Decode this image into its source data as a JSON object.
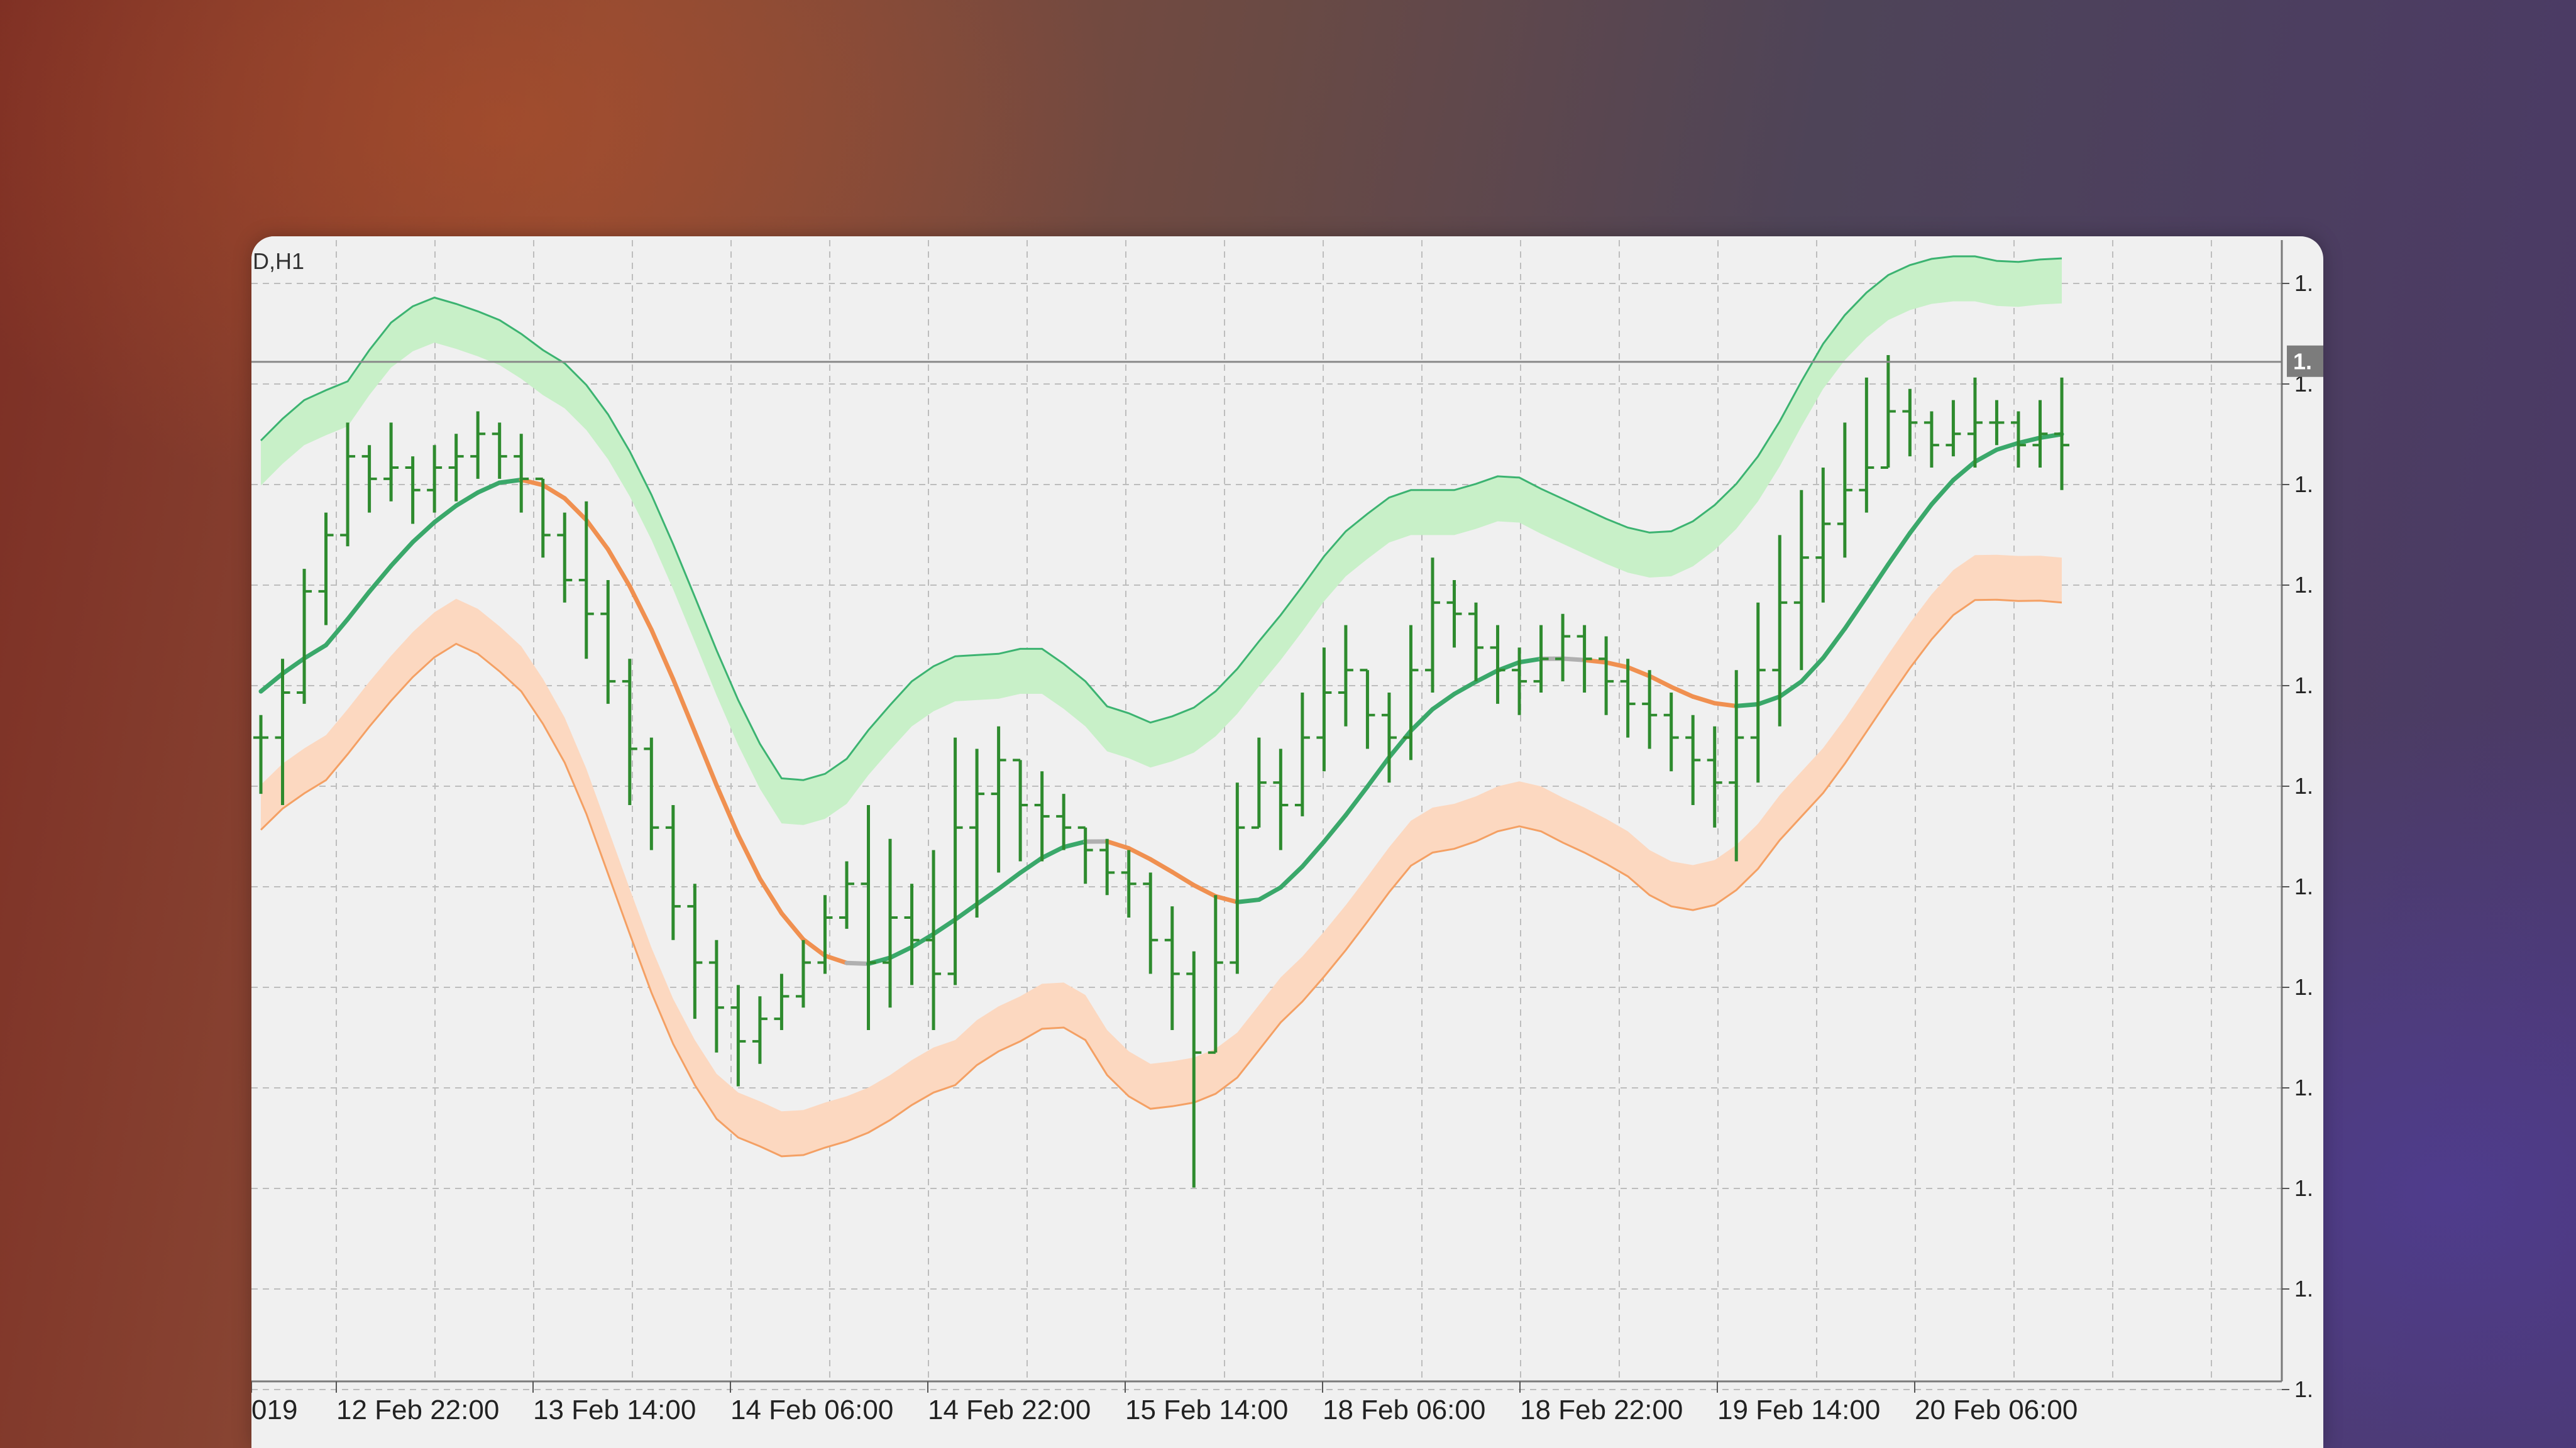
{
  "window": {
    "symbol_label": "D,H1"
  },
  "price_axis": {
    "tick_labels": [
      "1.",
      "1.",
      "1.",
      "1.",
      "1.",
      "1.",
      "1.",
      "1.",
      "1.",
      "1.",
      "1.",
      "1."
    ],
    "current_price_label": "1."
  },
  "colors": {
    "background": "#f0f0f0",
    "grid": "#bdbdbd",
    "bar": "#2e8b2e",
    "upper_band": "#3cb371",
    "upper_fill": "#c8f0c8",
    "lower_band": "#f4a064",
    "lower_fill": "#fcd8c0",
    "ma_up": "#3aa86a",
    "ma_down": "#f09050",
    "ma_flat": "#b0b0b0"
  },
  "chart_data": {
    "type": "ohlc",
    "title": "",
    "x_tick_labels": [
      "019",
      "12 Feb 22:00",
      "13 Feb 14:00",
      "14 Feb 06:00",
      "14 Feb 22:00",
      "15 Feb 14:00",
      "18 Feb 06:00",
      "18 Feb 22:00",
      "19 Feb 14:00",
      "20 Feb 06:00"
    ],
    "y_range": [
      0.0,
      100.0
    ],
    "y_note_values_are_relative_to_axis": true,
    "current_price": 89.4,
    "bars": [
      {
        "h": 58,
        "l": 51,
        "c": 56
      },
      {
        "h": 63,
        "l": 50,
        "c": 60
      },
      {
        "h": 71,
        "l": 59,
        "c": 69
      },
      {
        "h": 76,
        "l": 66,
        "c": 74
      },
      {
        "h": 84,
        "l": 73,
        "c": 81
      },
      {
        "h": 82,
        "l": 76,
        "c": 79
      },
      {
        "h": 84,
        "l": 77,
        "c": 80
      },
      {
        "h": 81,
        "l": 75,
        "c": 78
      },
      {
        "h": 82,
        "l": 76,
        "c": 80
      },
      {
        "h": 83,
        "l": 77,
        "c": 81
      },
      {
        "h": 85,
        "l": 79,
        "c": 83
      },
      {
        "h": 84,
        "l": 79,
        "c": 81
      },
      {
        "h": 83,
        "l": 76,
        "c": 79
      },
      {
        "h": 79,
        "l": 72,
        "c": 74
      },
      {
        "h": 76,
        "l": 68,
        "c": 70
      },
      {
        "h": 77,
        "l": 63,
        "c": 67
      },
      {
        "h": 70,
        "l": 59,
        "c": 61
      },
      {
        "h": 63,
        "l": 50,
        "c": 55
      },
      {
        "h": 56,
        "l": 46,
        "c": 48
      },
      {
        "h": 50,
        "l": 38,
        "c": 41
      },
      {
        "h": 43,
        "l": 31,
        "c": 36
      },
      {
        "h": 38,
        "l": 28,
        "c": 32
      },
      {
        "h": 34,
        "l": 25,
        "c": 29
      },
      {
        "h": 33,
        "l": 27,
        "c": 31
      },
      {
        "h": 35,
        "l": 30,
        "c": 33
      },
      {
        "h": 38,
        "l": 32,
        "c": 36
      },
      {
        "h": 42,
        "l": 35,
        "c": 40
      },
      {
        "h": 45,
        "l": 39,
        "c": 43
      },
      {
        "h": 50,
        "l": 30,
        "c": 36
      },
      {
        "h": 47,
        "l": 32,
        "c": 40
      },
      {
        "h": 43,
        "l": 34,
        "c": 38
      },
      {
        "h": 46,
        "l": 30,
        "c": 35
      },
      {
        "h": 56,
        "l": 34,
        "c": 48
      },
      {
        "h": 55,
        "l": 40,
        "c": 51
      },
      {
        "h": 57,
        "l": 44,
        "c": 54
      },
      {
        "h": 54,
        "l": 45,
        "c": 50
      },
      {
        "h": 53,
        "l": 45,
        "c": 49
      },
      {
        "h": 51,
        "l": 46,
        "c": 48
      },
      {
        "h": 48,
        "l": 43,
        "c": 46
      },
      {
        "h": 47,
        "l": 42,
        "c": 44
      },
      {
        "h": 46,
        "l": 40,
        "c": 43
      },
      {
        "h": 44,
        "l": 35,
        "c": 38
      },
      {
        "h": 41,
        "l": 30,
        "c": 35
      },
      {
        "h": 37,
        "l": 16,
        "c": 28
      },
      {
        "h": 42,
        "l": 28,
        "c": 36
      },
      {
        "h": 52,
        "l": 35,
        "c": 48
      },
      {
        "h": 56,
        "l": 48,
        "c": 52
      },
      {
        "h": 55,
        "l": 46,
        "c": 50
      },
      {
        "h": 60,
        "l": 49,
        "c": 56
      },
      {
        "h": 64,
        "l": 53,
        "c": 60
      },
      {
        "h": 66,
        "l": 57,
        "c": 62
      },
      {
        "h": 62,
        "l": 55,
        "c": 58
      },
      {
        "h": 60,
        "l": 52,
        "c": 56
      },
      {
        "h": 66,
        "l": 54,
        "c": 62
      },
      {
        "h": 72,
        "l": 60,
        "c": 68
      },
      {
        "h": 70,
        "l": 64,
        "c": 67
      },
      {
        "h": 68,
        "l": 61,
        "c": 64
      },
      {
        "h": 66,
        "l": 59,
        "c": 62
      },
      {
        "h": 64,
        "l": 58,
        "c": 61
      },
      {
        "h": 66,
        "l": 60,
        "c": 63
      },
      {
        "h": 67,
        "l": 61,
        "c": 65
      },
      {
        "h": 66,
        "l": 60,
        "c": 63
      },
      {
        "h": 65,
        "l": 58,
        "c": 61
      },
      {
        "h": 63,
        "l": 56,
        "c": 59
      },
      {
        "h": 62,
        "l": 55,
        "c": 58
      },
      {
        "h": 60,
        "l": 53,
        "c": 56
      },
      {
        "h": 58,
        "l": 50,
        "c": 54
      },
      {
        "h": 57,
        "l": 48,
        "c": 52
      },
      {
        "h": 62,
        "l": 45,
        "c": 56
      },
      {
        "h": 68,
        "l": 52,
        "c": 62
      },
      {
        "h": 74,
        "l": 57,
        "c": 68
      },
      {
        "h": 78,
        "l": 62,
        "c": 72
      },
      {
        "h": 80,
        "l": 68,
        "c": 75
      },
      {
        "h": 84,
        "l": 72,
        "c": 78
      },
      {
        "h": 88,
        "l": 76,
        "c": 80
      },
      {
        "h": 90,
        "l": 80,
        "c": 85
      },
      {
        "h": 87,
        "l": 81,
        "c": 84
      },
      {
        "h": 85,
        "l": 80,
        "c": 82
      },
      {
        "h": 86,
        "l": 81,
        "c": 83
      },
      {
        "h": 88,
        "l": 80,
        "c": 84
      },
      {
        "h": 86,
        "l": 82,
        "c": 84
      },
      {
        "h": 85,
        "l": 80,
        "c": 82
      },
      {
        "h": 86,
        "l": 80,
        "c": 83
      },
      {
        "h": 88,
        "l": 78,
        "c": 82
      }
    ]
  }
}
